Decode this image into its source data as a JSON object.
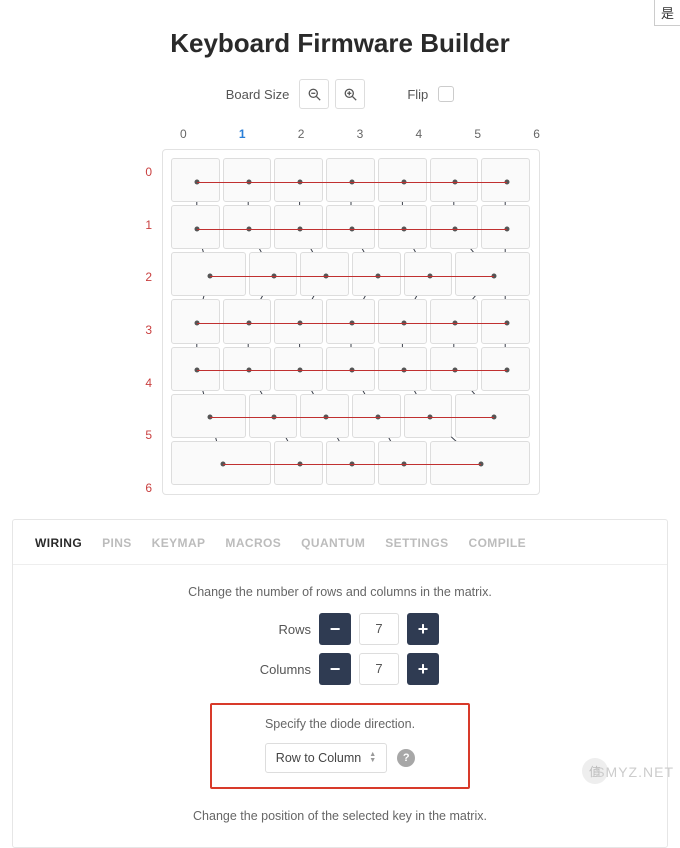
{
  "title": "Keyboard Firmware Builder",
  "top_controls": {
    "board_size_label": "Board Size",
    "flip_label": "Flip",
    "flip_checked": false
  },
  "board": {
    "col_labels": [
      "0",
      "1",
      "2",
      "3",
      "4",
      "5",
      "6"
    ],
    "active_col": 1,
    "row_labels": [
      "0",
      "1",
      "2",
      "3",
      "4",
      "5",
      "6"
    ],
    "cols": 7,
    "rows": 7,
    "keys": [
      {
        "r": 0,
        "c": 0,
        "w": 1
      },
      {
        "r": 0,
        "c": 1,
        "w": 1
      },
      {
        "r": 0,
        "c": 2,
        "w": 1
      },
      {
        "r": 0,
        "c": 3,
        "w": 1
      },
      {
        "r": 0,
        "c": 4,
        "w": 1
      },
      {
        "r": 0,
        "c": 5,
        "w": 1
      },
      {
        "r": 0,
        "c": 6,
        "w": 1
      },
      {
        "r": 1,
        "c": 0,
        "w": 1
      },
      {
        "r": 1,
        "c": 1,
        "w": 1
      },
      {
        "r": 1,
        "c": 2,
        "w": 1
      },
      {
        "r": 1,
        "c": 3,
        "w": 1
      },
      {
        "r": 1,
        "c": 4,
        "w": 1
      },
      {
        "r": 1,
        "c": 5,
        "w": 1
      },
      {
        "r": 1,
        "c": 6,
        "w": 1
      },
      {
        "r": 2,
        "c": 0,
        "w": 1.5
      },
      {
        "r": 2,
        "c": 1.5,
        "w": 1
      },
      {
        "r": 2,
        "c": 2.5,
        "w": 1
      },
      {
        "r": 2,
        "c": 3.5,
        "w": 1
      },
      {
        "r": 2,
        "c": 4.5,
        "w": 1
      },
      {
        "r": 2,
        "c": 5.5,
        "w": 1.5
      },
      {
        "r": 3,
        "c": 0,
        "w": 1
      },
      {
        "r": 3,
        "c": 1,
        "w": 1
      },
      {
        "r": 3,
        "c": 2,
        "w": 1
      },
      {
        "r": 3,
        "c": 3,
        "w": 1
      },
      {
        "r": 3,
        "c": 4,
        "w": 1
      },
      {
        "r": 3,
        "c": 5,
        "w": 1
      },
      {
        "r": 3,
        "c": 6,
        "w": 1
      },
      {
        "r": 4,
        "c": 0,
        "w": 1
      },
      {
        "r": 4,
        "c": 1,
        "w": 1
      },
      {
        "r": 4,
        "c": 2,
        "w": 1
      },
      {
        "r": 4,
        "c": 3,
        "w": 1
      },
      {
        "r": 4,
        "c": 4,
        "w": 1
      },
      {
        "r": 4,
        "c": 5,
        "w": 1
      },
      {
        "r": 4,
        "c": 6,
        "w": 1
      },
      {
        "r": 5,
        "c": 0,
        "w": 1.5
      },
      {
        "r": 5,
        "c": 1.5,
        "w": 1
      },
      {
        "r": 5,
        "c": 2.5,
        "w": 1
      },
      {
        "r": 5,
        "c": 3.5,
        "w": 1
      },
      {
        "r": 5,
        "c": 4.5,
        "w": 1
      },
      {
        "r": 5,
        "c": 5.5,
        "w": 1.5
      },
      {
        "r": 6,
        "c": 0,
        "w": 2
      },
      {
        "r": 6,
        "c": 2,
        "w": 1
      },
      {
        "r": 6,
        "c": 3,
        "w": 1
      },
      {
        "r": 6,
        "c": 4,
        "w": 1
      },
      {
        "r": 6,
        "c": 5,
        "w": 2
      }
    ],
    "row_lines": [
      {
        "r": 0,
        "c0": 0,
        "c1": 6
      },
      {
        "r": 1,
        "c0": 0,
        "c1": 6
      },
      {
        "r": 2,
        "c0": 0,
        "c1": 5.5,
        "offs": true
      },
      {
        "r": 3,
        "c0": 0,
        "c1": 6
      },
      {
        "r": 4,
        "c0": 0,
        "c1": 6
      },
      {
        "r": 5,
        "c0": 0,
        "c1": 5.5,
        "offs": true
      },
      {
        "r": 6,
        "c0": 0,
        "c1": 5,
        "offs6": true
      }
    ],
    "col_wires": [
      [
        [
          0.5,
          0
        ],
        [
          0.5,
          1
        ],
        [
          0.75,
          2
        ],
        [
          0.5,
          3
        ],
        [
          0.5,
          4
        ],
        [
          0.75,
          5
        ],
        [
          1.0,
          6
        ]
      ],
      [
        [
          1.5,
          0
        ],
        [
          1.5,
          1
        ],
        [
          2.0,
          2
        ],
        [
          1.5,
          3
        ],
        [
          1.5,
          4
        ],
        [
          2.0,
          5
        ],
        [
          2.5,
          6
        ]
      ],
      [
        [
          2.5,
          0
        ],
        [
          2.5,
          1
        ],
        [
          3.0,
          2
        ],
        [
          2.5,
          3
        ],
        [
          2.5,
          4
        ],
        [
          3.0,
          5
        ],
        [
          3.5,
          6
        ]
      ],
      [
        [
          3.5,
          0
        ],
        [
          3.5,
          1
        ],
        [
          4.0,
          2
        ],
        [
          3.5,
          3
        ],
        [
          3.5,
          4
        ],
        [
          4.0,
          5
        ],
        [
          4.5,
          6
        ]
      ],
      [
        [
          4.5,
          0
        ],
        [
          4.5,
          1
        ],
        [
          5.0,
          2
        ],
        [
          4.5,
          3
        ],
        [
          4.5,
          4
        ],
        [
          5.0,
          5
        ],
        [
          6.0,
          6
        ]
      ],
      [
        [
          5.5,
          0
        ],
        [
          5.5,
          1
        ],
        [
          6.25,
          2
        ],
        [
          5.5,
          3
        ],
        [
          5.5,
          4
        ],
        [
          6.25,
          5
        ]
      ],
      [
        [
          6.5,
          0
        ],
        [
          6.5,
          1
        ],
        [
          6.5,
          3
        ],
        [
          6.5,
          4
        ]
      ]
    ]
  },
  "tabs": {
    "items": [
      "WIRING",
      "PINS",
      "KEYMAP",
      "MACROS",
      "QUANTUM",
      "SETTINGS",
      "COMPILE"
    ],
    "active": 0
  },
  "wiring": {
    "matrix_note": "Change the number of rows and columns in the matrix.",
    "rows_label": "Rows",
    "rows_value": "7",
    "cols_label": "Columns",
    "cols_value": "7",
    "diode_note": "Specify the diode direction.",
    "diode_value": "Row to Column",
    "position_note": "Change the position of the selected key in the matrix."
  },
  "misc": {
    "corner_flag": "是",
    "watermark": "SMYZ.NET",
    "wm_badge": "值"
  }
}
